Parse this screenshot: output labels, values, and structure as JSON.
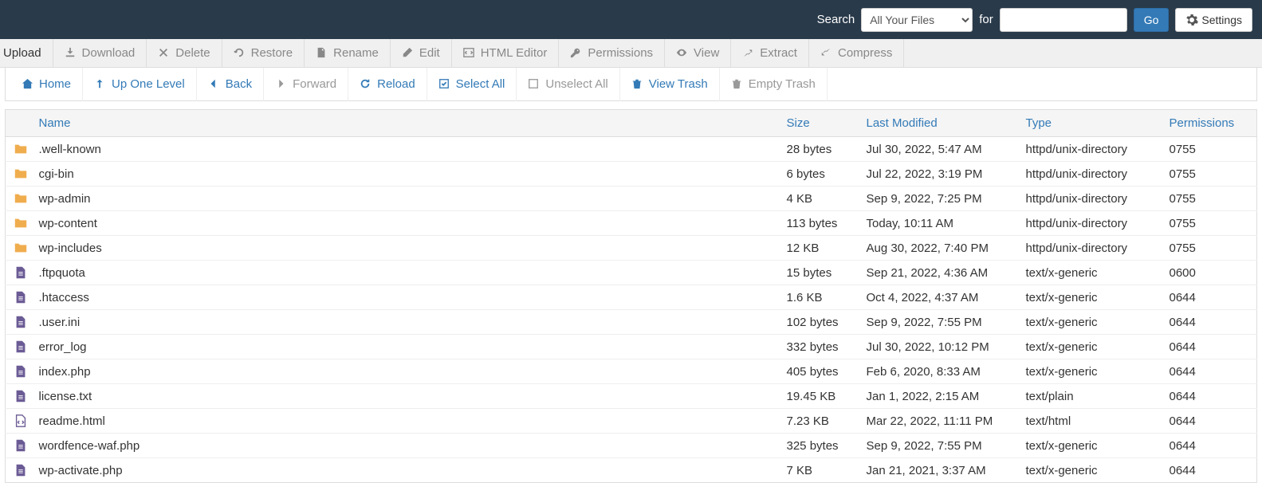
{
  "header": {
    "search_label": "Search",
    "for_label": "for",
    "select_value": "All Your Files",
    "search_value": "",
    "go_label": "Go",
    "settings_label": "Settings"
  },
  "toolbar1": [
    {
      "icon": "upload",
      "label": "Upload",
      "enabled": true
    },
    {
      "icon": "download",
      "label": "Download",
      "enabled": false
    },
    {
      "icon": "delete",
      "label": "Delete",
      "enabled": false
    },
    {
      "icon": "restore",
      "label": "Restore",
      "enabled": false
    },
    {
      "icon": "rename",
      "label": "Rename",
      "enabled": false
    },
    {
      "icon": "edit",
      "label": "Edit",
      "enabled": false
    },
    {
      "icon": "html-editor",
      "label": "HTML Editor",
      "enabled": false
    },
    {
      "icon": "permissions",
      "label": "Permissions",
      "enabled": false
    },
    {
      "icon": "view",
      "label": "View",
      "enabled": false
    },
    {
      "icon": "extract",
      "label": "Extract",
      "enabled": false
    },
    {
      "icon": "compress",
      "label": "Compress",
      "enabled": false
    }
  ],
  "toolbar2": [
    {
      "icon": "home",
      "label": "Home",
      "enabled": true
    },
    {
      "icon": "up",
      "label": "Up One Level",
      "enabled": true
    },
    {
      "icon": "back",
      "label": "Back",
      "enabled": true
    },
    {
      "icon": "forward",
      "label": "Forward",
      "enabled": false
    },
    {
      "icon": "reload",
      "label": "Reload",
      "enabled": true
    },
    {
      "icon": "select-all",
      "label": "Select All",
      "enabled": true
    },
    {
      "icon": "unselect-all",
      "label": "Unselect All",
      "enabled": false
    },
    {
      "icon": "trash",
      "label": "View Trash",
      "enabled": true
    },
    {
      "icon": "empty-trash",
      "label": "Empty Trash",
      "enabled": false
    }
  ],
  "columns": {
    "name": "Name",
    "size": "Size",
    "modified": "Last Modified",
    "type": "Type",
    "permissions": "Permissions"
  },
  "files": [
    {
      "icon": "folder",
      "name": ".well-known",
      "size": "28 bytes",
      "modified": "Jul 30, 2022, 5:47 AM",
      "type": "httpd/unix-directory",
      "perm": "0755"
    },
    {
      "icon": "folder",
      "name": "cgi-bin",
      "size": "6 bytes",
      "modified": "Jul 22, 2022, 3:19 PM",
      "type": "httpd/unix-directory",
      "perm": "0755"
    },
    {
      "icon": "folder",
      "name": "wp-admin",
      "size": "4 KB",
      "modified": "Sep 9, 2022, 7:25 PM",
      "type": "httpd/unix-directory",
      "perm": "0755"
    },
    {
      "icon": "folder",
      "name": "wp-content",
      "size": "113 bytes",
      "modified": "Today, 10:11 AM",
      "type": "httpd/unix-directory",
      "perm": "0755"
    },
    {
      "icon": "folder",
      "name": "wp-includes",
      "size": "12 KB",
      "modified": "Aug 30, 2022, 7:40 PM",
      "type": "httpd/unix-directory",
      "perm": "0755"
    },
    {
      "icon": "file",
      "name": ".ftpquota",
      "size": "15 bytes",
      "modified": "Sep 21, 2022, 4:36 AM",
      "type": "text/x-generic",
      "perm": "0600"
    },
    {
      "icon": "file",
      "name": ".htaccess",
      "size": "1.6 KB",
      "modified": "Oct 4, 2022, 4:37 AM",
      "type": "text/x-generic",
      "perm": "0644"
    },
    {
      "icon": "file",
      "name": ".user.ini",
      "size": "102 bytes",
      "modified": "Sep 9, 2022, 7:55 PM",
      "type": "text/x-generic",
      "perm": "0644"
    },
    {
      "icon": "file",
      "name": "error_log",
      "size": "332 bytes",
      "modified": "Jul 30, 2022, 10:12 PM",
      "type": "text/x-generic",
      "perm": "0644"
    },
    {
      "icon": "file",
      "name": "index.php",
      "size": "405 bytes",
      "modified": "Feb 6, 2020, 8:33 AM",
      "type": "text/x-generic",
      "perm": "0644"
    },
    {
      "icon": "file",
      "name": "license.txt",
      "size": "19.45 KB",
      "modified": "Jan 1, 2022, 2:15 AM",
      "type": "text/plain",
      "perm": "0644"
    },
    {
      "icon": "html",
      "name": "readme.html",
      "size": "7.23 KB",
      "modified": "Mar 22, 2022, 11:11 PM",
      "type": "text/html",
      "perm": "0644"
    },
    {
      "icon": "file",
      "name": "wordfence-waf.php",
      "size": "325 bytes",
      "modified": "Sep 9, 2022, 7:55 PM",
      "type": "text/x-generic",
      "perm": "0644"
    },
    {
      "icon": "file",
      "name": "wp-activate.php",
      "size": "7 KB",
      "modified": "Jan 21, 2021, 3:37 AM",
      "type": "text/x-generic",
      "perm": "0644"
    }
  ]
}
